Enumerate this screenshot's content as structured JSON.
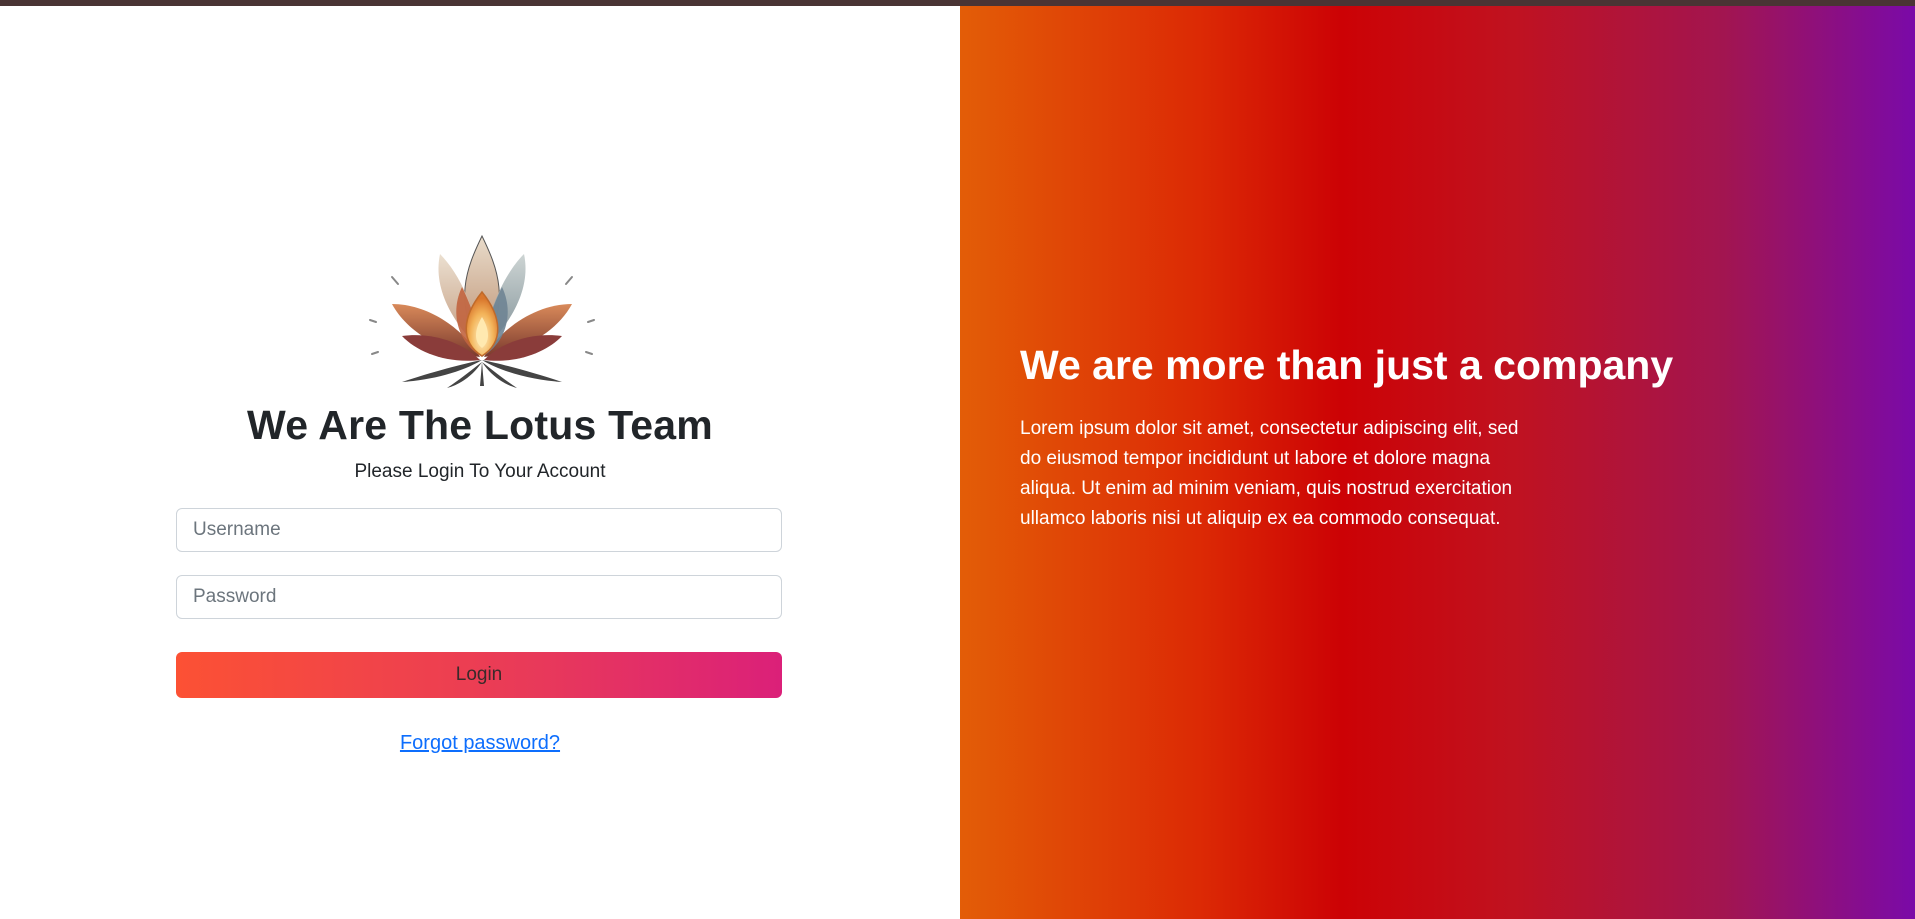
{
  "login": {
    "title": "We Are The Lotus Team",
    "subtitle": "Please Login To Your Account",
    "username_placeholder": "Username",
    "password_placeholder": "Password",
    "login_label": "Login",
    "forgot_label": "Forgot password?"
  },
  "promo": {
    "headline": "We are more than just a company",
    "body": "Lorem ipsum dolor sit amet, consectetur adipiscing elit, sed do eiusmod tempor incididunt ut labore et dolore magna aliqua. Ut enim ad minim veniam, quis nostrud exercitation ullamco laboris nisi ut aliquip ex ea commodo consequat."
  },
  "icons": {
    "logo": "lotus-logo-icon"
  },
  "colors": {
    "link": "#0d6efd",
    "button_start": "#fc5134",
    "button_end": "#db2079",
    "panel_start": "#e35d07",
    "panel_mid": "#cc0205",
    "panel_end": "#7a0aa8"
  }
}
